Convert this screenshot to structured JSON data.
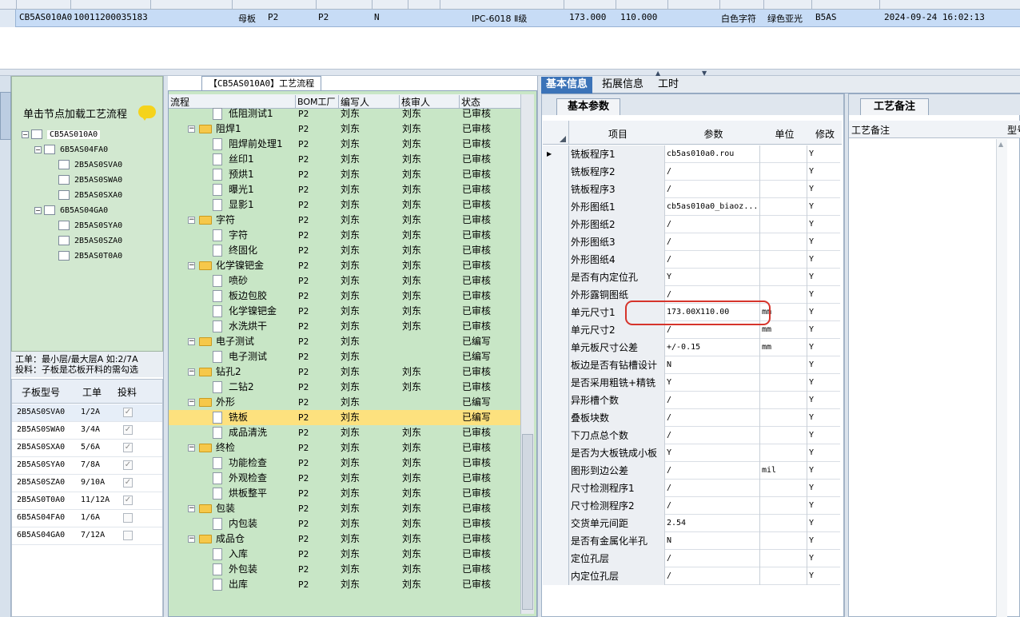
{
  "top_grid": {
    "row": {
      "code": "CB5AS010A0",
      "number": "10011200035183",
      "type": "母板",
      "factory1": "P2",
      "factory2": "P2",
      "flag": "N",
      "standard": "IPC-6018 Ⅱ级",
      "length": "173.000",
      "width": "110.000",
      "char_color": "白色字符",
      "mask_color": "绿色亚光",
      "sub_code": "B5AS",
      "datetime": "2024-09-24 16:02:13"
    }
  },
  "tree_panel": {
    "hint": "单击节点加载工艺流程",
    "nodes": [
      {
        "label": "CB5AS010A0",
        "expander": "−"
      },
      {
        "label": "6B5AS04FA0",
        "expander": "−"
      },
      {
        "label": "2B5AS0SVA0",
        "expander": ""
      },
      {
        "label": "2B5AS0SWA0",
        "expander": ""
      },
      {
        "label": "2B5AS0SXA0",
        "expander": ""
      },
      {
        "label": "6B5AS04GA0",
        "expander": "−"
      },
      {
        "label": "2B5AS0SYA0",
        "expander": ""
      },
      {
        "label": "2B5AS0SZA0",
        "expander": ""
      },
      {
        "label": "2B5AS0T0A0",
        "expander": ""
      }
    ],
    "order_line1": "工单：最小层/最大层A 如:2/7A",
    "order_line2": "投料：子板是芯板开料的需勾选"
  },
  "sub_table": {
    "headers": [
      "子板型号",
      "工单",
      "投料"
    ],
    "rows": [
      {
        "model": "2B5AS0SVA0",
        "order": "1/2A",
        "checked": true
      },
      {
        "model": "2B5AS0SWA0",
        "order": "3/4A",
        "checked": true
      },
      {
        "model": "2B5AS0SXA0",
        "order": "5/6A",
        "checked": true
      },
      {
        "model": "2B5AS0SYA0",
        "order": "7/8A",
        "checked": true
      },
      {
        "model": "2B5AS0SZA0",
        "order": "9/10A",
        "checked": true
      },
      {
        "model": "2B5AS0T0A0",
        "order": "11/12A",
        "checked": true
      },
      {
        "model": "6B5AS04FA0",
        "order": "1/6A",
        "checked": false
      },
      {
        "model": "6B5AS04GA0",
        "order": "7/12A",
        "checked": false
      }
    ]
  },
  "process_panel": {
    "title": "【CB5AS010A0】工艺流程",
    "headers": [
      "流程",
      "BOM工厂",
      "编写人",
      "核审人",
      "状态"
    ],
    "rows": [
      {
        "name": "低阻测试1",
        "kind": "file",
        "factory": "P2",
        "writer": "刘东",
        "reviewer": "刘东",
        "status": "已审核"
      },
      {
        "name": "阻焊1",
        "kind": "folder",
        "factory": "P2",
        "writer": "刘东",
        "reviewer": "刘东",
        "status": "已审核"
      },
      {
        "name": "阻焊前处理1",
        "kind": "file",
        "factory": "P2",
        "writer": "刘东",
        "reviewer": "刘东",
        "status": "已审核"
      },
      {
        "name": "丝印1",
        "kind": "file",
        "factory": "P2",
        "writer": "刘东",
        "reviewer": "刘东",
        "status": "已审核"
      },
      {
        "name": "预烘1",
        "kind": "file",
        "factory": "P2",
        "writer": "刘东",
        "reviewer": "刘东",
        "status": "已审核"
      },
      {
        "name": "曝光1",
        "kind": "file",
        "factory": "P2",
        "writer": "刘东",
        "reviewer": "刘东",
        "status": "已审核"
      },
      {
        "name": "显影1",
        "kind": "file",
        "factory": "P2",
        "writer": "刘东",
        "reviewer": "刘东",
        "status": "已审核"
      },
      {
        "name": "字符",
        "kind": "folder",
        "factory": "P2",
        "writer": "刘东",
        "reviewer": "刘东",
        "status": "已审核"
      },
      {
        "name": "字符",
        "kind": "file",
        "factory": "P2",
        "writer": "刘东",
        "reviewer": "刘东",
        "status": "已审核"
      },
      {
        "name": "终固化",
        "kind": "file",
        "factory": "P2",
        "writer": "刘东",
        "reviewer": "刘东",
        "status": "已审核"
      },
      {
        "name": "化学镍钯金",
        "kind": "folder",
        "factory": "P2",
        "writer": "刘东",
        "reviewer": "刘东",
        "status": "已审核"
      },
      {
        "name": "喷砂",
        "kind": "file",
        "factory": "P2",
        "writer": "刘东",
        "reviewer": "刘东",
        "status": "已审核"
      },
      {
        "name": "板边包胶",
        "kind": "file",
        "factory": "P2",
        "writer": "刘东",
        "reviewer": "刘东",
        "status": "已审核"
      },
      {
        "name": "化学镍钯金",
        "kind": "file",
        "factory": "P2",
        "writer": "刘东",
        "reviewer": "刘东",
        "status": "已审核"
      },
      {
        "name": "水洗烘干",
        "kind": "file",
        "factory": "P2",
        "writer": "刘东",
        "reviewer": "刘东",
        "status": "已审核"
      },
      {
        "name": "电子测试",
        "kind": "folder",
        "factory": "P2",
        "writer": "刘东",
        "reviewer": "",
        "status": "已编写"
      },
      {
        "name": "电子测试",
        "kind": "file",
        "factory": "P2",
        "writer": "刘东",
        "reviewer": "",
        "status": "已编写"
      },
      {
        "name": "钻孔2",
        "kind": "folder",
        "factory": "P2",
        "writer": "刘东",
        "reviewer": "刘东",
        "status": "已审核"
      },
      {
        "name": "二钻2",
        "kind": "file",
        "factory": "P2",
        "writer": "刘东",
        "reviewer": "刘东",
        "status": "已审核"
      },
      {
        "name": "外形",
        "kind": "folder",
        "factory": "P2",
        "writer": "刘东",
        "reviewer": "",
        "status": "已编写"
      },
      {
        "name": "铣板",
        "kind": "file",
        "factory": "P2",
        "writer": "刘东",
        "reviewer": "",
        "status": "已编写",
        "highlight": true
      },
      {
        "name": "成品清洗",
        "kind": "file",
        "factory": "P2",
        "writer": "刘东",
        "reviewer": "刘东",
        "status": "已审核"
      },
      {
        "name": "终检",
        "kind": "folder",
        "factory": "P2",
        "writer": "刘东",
        "reviewer": "刘东",
        "status": "已审核"
      },
      {
        "name": "功能检查",
        "kind": "file",
        "factory": "P2",
        "writer": "刘东",
        "reviewer": "刘东",
        "status": "已审核"
      },
      {
        "name": "外观检查",
        "kind": "file",
        "factory": "P2",
        "writer": "刘东",
        "reviewer": "刘东",
        "status": "已审核"
      },
      {
        "name": "烘板整平",
        "kind": "file",
        "factory": "P2",
        "writer": "刘东",
        "reviewer": "刘东",
        "status": "已审核"
      },
      {
        "name": "包装",
        "kind": "folder",
        "factory": "P2",
        "writer": "刘东",
        "reviewer": "刘东",
        "status": "已审核"
      },
      {
        "name": "内包装",
        "kind": "file",
        "factory": "P2",
        "writer": "刘东",
        "reviewer": "刘东",
        "status": "已审核"
      },
      {
        "name": "成品仓",
        "kind": "folder",
        "factory": "P2",
        "writer": "刘东",
        "reviewer": "刘东",
        "status": "已审核"
      },
      {
        "name": "入库",
        "kind": "file",
        "factory": "P2",
        "writer": "刘东",
        "reviewer": "刘东",
        "status": "已审核"
      },
      {
        "name": "外包装",
        "kind": "file",
        "factory": "P2",
        "writer": "刘东",
        "reviewer": "刘东",
        "status": "已审核"
      },
      {
        "name": "出库",
        "kind": "file",
        "factory": "P2",
        "writer": "刘东",
        "reviewer": "刘东",
        "status": "已审核"
      }
    ]
  },
  "right_tabs": [
    "基本信息",
    "拓展信息",
    "工时"
  ],
  "params_panel": {
    "tab": "基本参数",
    "headers": [
      "项目",
      "参数",
      "单位",
      "修改"
    ],
    "rows": [
      {
        "item": "铣板程序1",
        "value": "cb5as010a0.rou",
        "unit": "",
        "mod": "Y",
        "current": true
      },
      {
        "item": "铣板程序2",
        "value": "/",
        "unit": "",
        "mod": "Y"
      },
      {
        "item": "铣板程序3",
        "value": "/",
        "unit": "",
        "mod": "Y"
      },
      {
        "item": "外形图纸1",
        "value": "cb5as010a0_biaoz...",
        "unit": "",
        "mod": "Y"
      },
      {
        "item": "外形图纸2",
        "value": "/",
        "unit": "",
        "mod": "Y"
      },
      {
        "item": "外形图纸3",
        "value": "/",
        "unit": "",
        "mod": "Y"
      },
      {
        "item": "外形图纸4",
        "value": "/",
        "unit": "",
        "mod": "Y"
      },
      {
        "item": "是否有内定位孔",
        "value": "Y",
        "unit": "",
        "mod": "Y"
      },
      {
        "item": "外形露铜图纸",
        "value": "/",
        "unit": "",
        "mod": "Y"
      },
      {
        "item": "单元尺寸1",
        "value": "173.00X110.00",
        "unit": "mm",
        "mod": "Y",
        "circled": true
      },
      {
        "item": "单元尺寸2",
        "value": "/",
        "unit": "mm",
        "mod": "Y"
      },
      {
        "item": "单元板尺寸公差",
        "value": "+/-0.15",
        "unit": "mm",
        "mod": "Y"
      },
      {
        "item": "板边是否有钻槽设计",
        "value": "N",
        "unit": "",
        "mod": "Y"
      },
      {
        "item": "是否采用粗铣+精铣",
        "value": "Y",
        "unit": "",
        "mod": "Y"
      },
      {
        "item": "异形槽个数",
        "value": "/",
        "unit": "",
        "mod": "Y"
      },
      {
        "item": "叠板块数",
        "value": "/",
        "unit": "",
        "mod": "Y"
      },
      {
        "item": "下刀点总个数",
        "value": "/",
        "unit": "",
        "mod": "Y"
      },
      {
        "item": "是否为大板铣成小板",
        "value": "Y",
        "unit": "",
        "mod": "Y"
      },
      {
        "item": "图形到边公差",
        "value": "/",
        "unit": "mil",
        "mod": "Y"
      },
      {
        "item": "尺寸检测程序1",
        "value": "/",
        "unit": "",
        "mod": "Y"
      },
      {
        "item": "尺寸检测程序2",
        "value": "/",
        "unit": "",
        "mod": "Y"
      },
      {
        "item": "交货单元间距",
        "value": "2.54",
        "unit": "",
        "mod": "Y"
      },
      {
        "item": "是否有金属化半孔",
        "value": "N",
        "unit": "",
        "mod": "Y"
      },
      {
        "item": "定位孔层",
        "value": "/",
        "unit": "",
        "mod": "Y"
      },
      {
        "item": "内定位孔层",
        "value": "/",
        "unit": "",
        "mod": "Y"
      }
    ]
  },
  "notes_panel": {
    "tab": "工艺备注",
    "header_left": "工艺备注",
    "header_right": "型号"
  },
  "colors": {
    "tree_bg": "#d2e8d0",
    "process_bg": "#c8e6c6",
    "highlight_row": "#fde17e",
    "active_tab": "#3b73b8",
    "annotation_ring": "#d6342b"
  }
}
